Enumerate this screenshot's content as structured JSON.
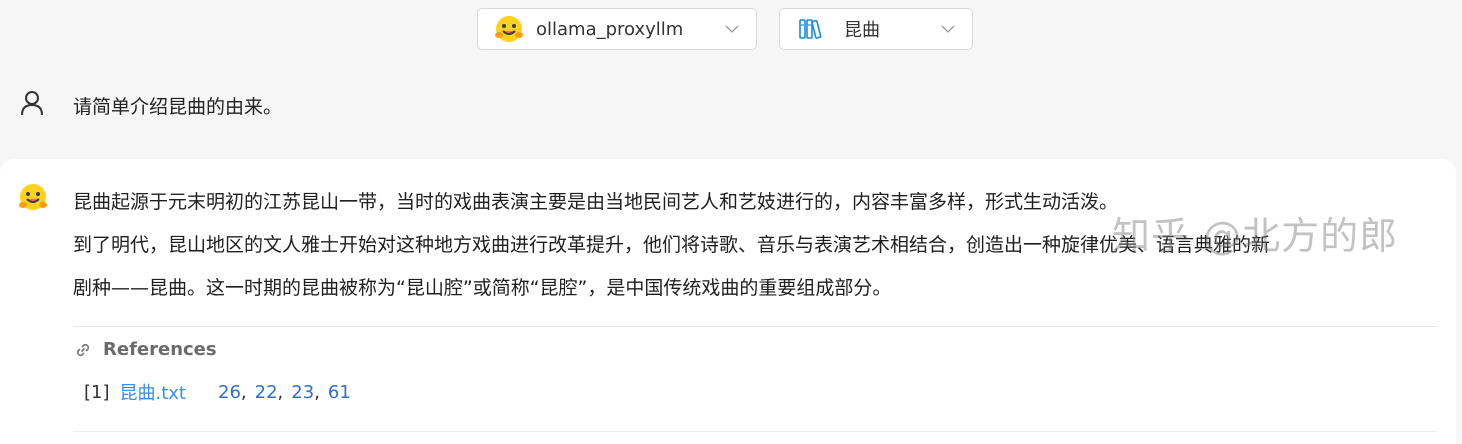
{
  "top_bar": {
    "model_selector": {
      "value": "ollama_proxyllm",
      "icon": "hugging-face-emoji-icon"
    },
    "knowledge_selector": {
      "value": "昆曲",
      "icon": "books-icon"
    }
  },
  "user_message": {
    "text": "请简单介绍昆曲的由来。"
  },
  "assistant_message": {
    "lines": [
      "昆曲起源于元末明初的江苏昆山一带，当时的戏曲表演主要是由当地民间艺人和艺妓进行的，内容丰富多样，形式生动活泼。",
      "到了明代，昆山地区的文人雅士开始对这种地方戏曲进行改革提升，他们将诗歌、音乐与表演艺术相结合，创造出一种旋律优美、语言典雅的新",
      "剧种——昆曲。这一时期的昆曲被称为“昆山腔”或简称“昆腔”，是中国传统戏曲的重要组成部分。"
    ],
    "references": {
      "title": "References",
      "items": [
        {
          "index": "[1]",
          "file": "昆曲.txt",
          "chunks": [
            "26",
            "22",
            "23",
            "61"
          ]
        }
      ]
    }
  },
  "watermark": "知乎 @北方的郎",
  "colors": {
    "background": "#f6f6f7",
    "card": "#ffffff",
    "link": "#3a8ee6",
    "chunk_link": "#2f6fc6",
    "muted": "#6b6b6b"
  }
}
